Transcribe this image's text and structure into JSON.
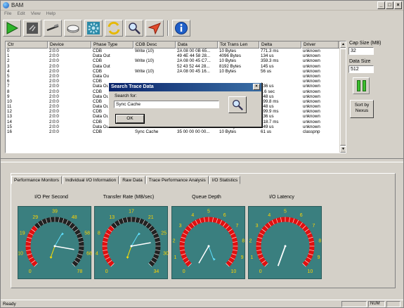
{
  "window": {
    "title": "BAM"
  },
  "menu": [
    "File",
    "Edit",
    "View",
    "Help"
  ],
  "toolbar": {
    "buttons": [
      "play-icon",
      "stop-icon",
      "cable-icon",
      "disk-icon",
      "settings-gear-icon",
      "refresh-icon",
      "search-icon",
      "send-icon",
      "info-icon"
    ]
  },
  "table": {
    "columns": [
      "Ctr",
      "Device",
      "Phase Type",
      "CDB Desc",
      "Data",
      "Tot Trans Len",
      "Delta",
      "Driver"
    ],
    "rows": [
      [
        "0",
        "2:0:0",
        "CDB",
        "Write (10)",
        "2A 08 00 0B 65...",
        "10 Bytes",
        "771.3 ms",
        "unknown"
      ],
      [
        "1",
        "2:0:0",
        "Data Out",
        "",
        "49 4E 44 58 28...",
        "4096 Bytes",
        "134 us",
        "unknown"
      ],
      [
        "2",
        "2:0:0",
        "CDB",
        "Write (10)",
        "2A 08 00 45 C7...",
        "10 Bytes",
        "359.3 ms",
        "unknown"
      ],
      [
        "3",
        "2:0:0",
        "Data Out",
        "",
        "52 43 52 44 28...",
        "8192 Bytes",
        "145 us",
        "unknown"
      ],
      [
        "4",
        "2:0:0",
        "CDB",
        "Write (10)",
        "2A 08 00 45 16...",
        "10 Bytes",
        "56 us",
        "unknown"
      ],
      [
        "5",
        "2:0:0",
        "Data Ou",
        "",
        "",
        "",
        "",
        "unknown"
      ],
      [
        "6",
        "2:0:0",
        "CDB",
        "",
        "",
        "",
        "",
        "unknown"
      ],
      [
        "7",
        "2:0:0",
        "Data Ou",
        "",
        "",
        "",
        "136 us",
        "unknown"
      ],
      [
        "8",
        "2:0:0",
        "CDB",
        "",
        "",
        "",
        "1.6 sec",
        "unknown"
      ],
      [
        "9",
        "2:0:0",
        "Data Ou",
        "",
        "",
        "",
        "148 us",
        "unknown"
      ],
      [
        "10",
        "2:0:0",
        "CDB",
        "",
        "",
        "",
        "399.8 ms",
        "unknown"
      ],
      [
        "11",
        "2:0:0",
        "Data Ou",
        "",
        "",
        "",
        "148 us",
        "unknown"
      ],
      [
        "12",
        "2:0:0",
        "CDB",
        "",
        "",
        "",
        "399.9 ms",
        "unknown"
      ],
      [
        "13",
        "2:0:0",
        "Data Out",
        "",
        "49 4E 44 58 28...",
        "4096 Bytes",
        "136 us",
        "unknown"
      ],
      [
        "14",
        "2:0:0",
        "CDB",
        "Write (10)",
        "2A 08 00 45 16...",
        "10 Bytes",
        "218.7 ms",
        "unknown"
      ],
      [
        "15",
        "2:0:0",
        "Data Out",
        "",
        "52 43 52 44 28...",
        "4096 Bytes",
        "149 us",
        "unknown"
      ],
      [
        "16",
        "2:0:0",
        "CDB",
        "Sync Cache",
        "35 00 00 00 00...",
        "10 Bytes",
        "61 us",
        "classpnp"
      ]
    ]
  },
  "right_panel": {
    "cap_size_label": "Cap Size (MB)",
    "cap_size_value": "32",
    "data_size_label": "Data Size",
    "data_size_value": "512",
    "sort_button": "Sort by Nexus"
  },
  "tabs": [
    "Performance Monitors",
    "Individual I/O Information",
    "Raw Data",
    "Trace Performance Analysis",
    "I/O Statistics"
  ],
  "gauges": [
    {
      "title": "I/O Per Second",
      "ticks": [
        "0",
        "10",
        "19",
        "29",
        "39",
        "48",
        "58",
        "68",
        "78"
      ],
      "bg": "#3a7f7f",
      "scale_color": "#222222",
      "red_color": "#e01010"
    },
    {
      "title": "Transfer Rate (MB/sec)",
      "ticks": [
        "0",
        "4",
        "8",
        "13",
        "17",
        "21",
        "25",
        "30",
        "34"
      ],
      "bg": "#3a7f7f",
      "scale_color": "#222222",
      "red_color": "#e01010"
    },
    {
      "title": "Queue Depth",
      "ticks": [
        "0",
        "1",
        "2",
        "3",
        "4",
        "5",
        "6",
        "7",
        "8",
        "9",
        "10"
      ],
      "bg": "#3a7f7f",
      "scale_color": "#e01010",
      "red_color": "#e01010"
    },
    {
      "title": "I/O Latency",
      "ticks": [
        "0",
        "1",
        "2",
        "3",
        "4",
        "5",
        "6",
        "7",
        "8",
        "9",
        "10"
      ],
      "bg": "#3a7f7f",
      "scale_color": "#e01010",
      "red_color": "#e01010"
    }
  ],
  "dialog": {
    "title": "Search Trace Data",
    "label": "Search for:",
    "value": "Sync Cache",
    "ok": "OK"
  },
  "status": {
    "text": "Ready",
    "num": "NUM"
  }
}
